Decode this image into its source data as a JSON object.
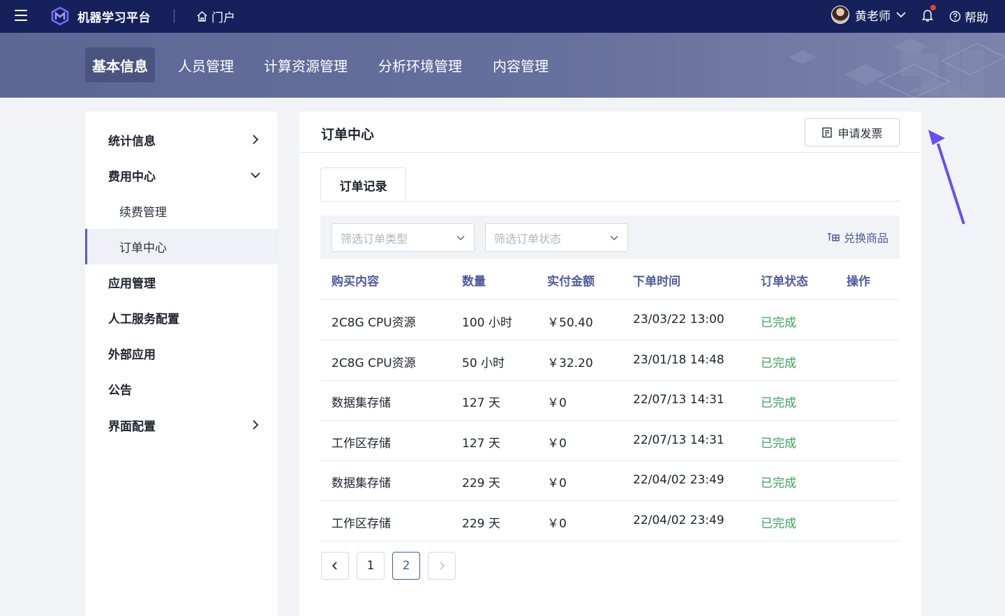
{
  "topbar": {
    "app_title": "机器学习平台",
    "portal_label": "门户",
    "user_name": "黄老师",
    "help_label": "帮助"
  },
  "nav": {
    "tabs": [
      {
        "label": "基本信息",
        "active": true
      },
      {
        "label": "人员管理"
      },
      {
        "label": "计算资源管理"
      },
      {
        "label": "分析环境管理"
      },
      {
        "label": "内容管理"
      }
    ]
  },
  "sidebar": {
    "items": [
      {
        "label": "统计信息"
      },
      {
        "label": "费用中心"
      },
      {
        "label": "续费管理"
      },
      {
        "label": "订单中心",
        "selected": true
      },
      {
        "label": "应用管理"
      },
      {
        "label": "人工服务配置"
      },
      {
        "label": "外部应用"
      },
      {
        "label": "公告"
      },
      {
        "label": "界面配置"
      }
    ]
  },
  "main": {
    "title": "订单中心",
    "invoice_label": "申请发票",
    "subtab_label": "订单记录",
    "filter_type_placeholder": "筛选订单类型",
    "filter_status_placeholder": "筛选订单状态",
    "redeem_label": "兑换商品",
    "columns": [
      "购买内容",
      "数量",
      "实付金额",
      "下单时间",
      "订单状态",
      "操作"
    ],
    "rows": [
      {
        "content": "2C8G CPU资源",
        "qty": "100 小时",
        "amount": "￥50.40",
        "time": "23/03/22 13:00",
        "status": "已完成"
      },
      {
        "content": "2C8G CPU资源",
        "qty": "50 小时",
        "amount": "￥32.20",
        "time": "23/01/18 14:48",
        "status": "已完成"
      },
      {
        "content": "数据集存储",
        "qty": "127 天",
        "amount": "￥0",
        "time": "22/07/13 14:31",
        "status": "已完成"
      },
      {
        "content": "工作区存储",
        "qty": "127 天",
        "amount": "￥0",
        "time": "22/07/13 14:31",
        "status": "已完成"
      },
      {
        "content": "数据集存储",
        "qty": "229 天",
        "amount": "￥0",
        "time": "22/04/02 23:49",
        "status": "已完成"
      },
      {
        "content": "工作区存储",
        "qty": "229 天",
        "amount": "￥0",
        "time": "22/04/02 23:49",
        "status": "已完成"
      }
    ],
    "pagination": {
      "pages": [
        "1",
        "2"
      ],
      "current": "2"
    }
  },
  "colors": {
    "topbar": "#16205a",
    "accent": "#5b55c9",
    "status_done": "#3aa35a",
    "table_header": "#4e5b9e"
  }
}
